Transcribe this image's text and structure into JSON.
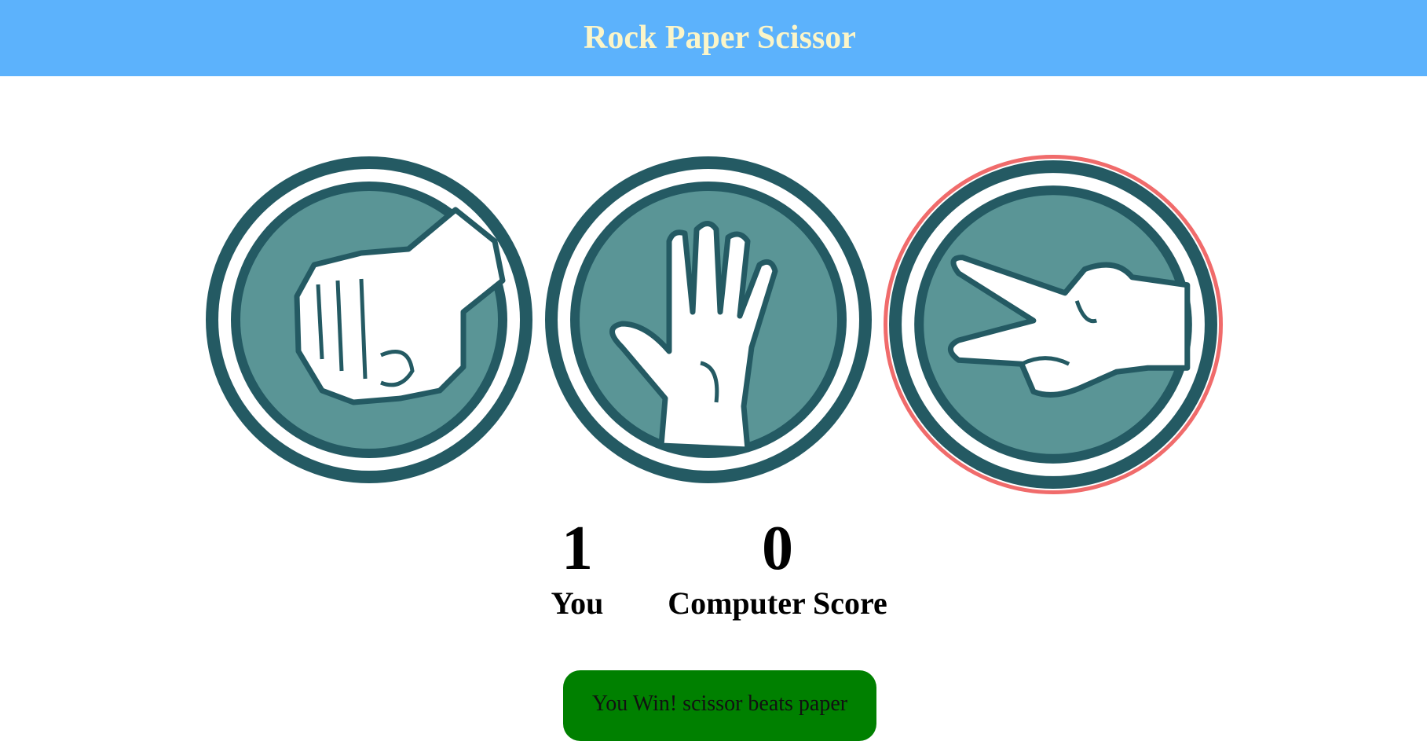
{
  "header": {
    "title": "Rock Paper Scissor"
  },
  "choices": [
    {
      "id": "rock",
      "icon": "rock-fist-icon"
    },
    {
      "id": "paper",
      "icon": "paper-hand-icon"
    },
    {
      "id": "scissor",
      "icon": "scissor-hand-icon",
      "selected": true
    }
  ],
  "scoreboard": {
    "user_score": "1",
    "user_label": "You",
    "computer_score": "0",
    "computer_label": "Computer Score"
  },
  "message": {
    "text": "You Win! scissor beats paper"
  },
  "colors": {
    "header_bg": "#5cb2fc",
    "header_text": "#fbf5c8",
    "circle_dark": "#245a63",
    "circle_mid": "#5a9596",
    "selected_border": "#f06b6b",
    "win_bg": "#008000"
  }
}
